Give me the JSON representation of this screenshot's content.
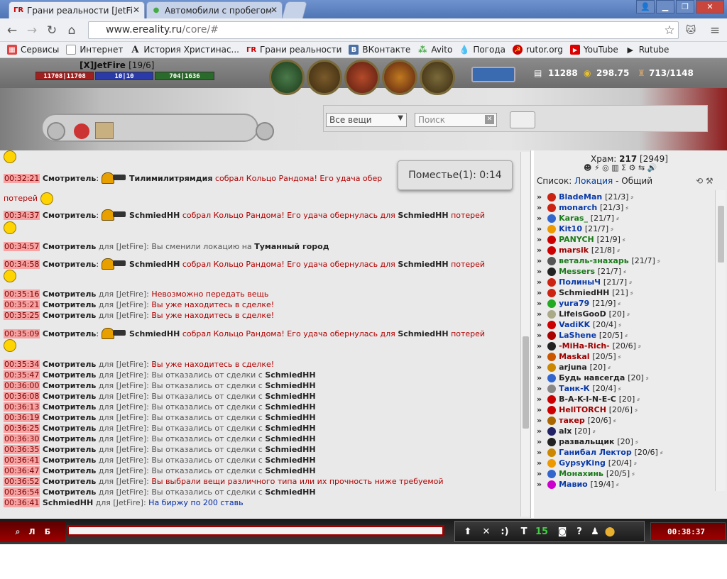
{
  "tabs": [
    {
      "label": "Грани реальности [JetFire"
    },
    {
      "label": "Автомобили с пробегом"
    }
  ],
  "url": {
    "host": "www.ereality.ru",
    "path": "/core/#"
  },
  "bookmarks": [
    "Сервисы",
    "Интернет",
    "История Христинас...",
    "Грани реальности",
    "ВКонтакте",
    "Avito",
    "Погода",
    "rutor.org",
    "YouTube",
    "Rutube"
  ],
  "player": {
    "name": "[X]JetFire",
    "level": "[19/6]",
    "hp": "11708|11708",
    "mana": "10|10",
    "exp": "704|1636"
  },
  "resources": {
    "silver": "11288",
    "gold": "298.75",
    "weight": "713/1148"
  },
  "filter": {
    "category": "Все вещи",
    "search_placeholder": "Поиск"
  },
  "popup": "Поместье(1): 0:14",
  "chat": [
    {
      "t": "00:32:21",
      "who": "Смотритель",
      "to": "",
      "nick": "Тилимилитрямдия",
      "msg": "собрал Кольцо Рандома! Его удача обер",
      "kind": "ring"
    },
    {
      "t": "",
      "who": "",
      "to": "",
      "nick": "",
      "msg": "потерей",
      "kind": "cont"
    },
    {
      "t": "00:34:37",
      "who": "Смотритель",
      "to": "",
      "nick": "SchmiedHH",
      "msg": "собрал Кольцо Рандома! Его удача обернулась для",
      "nick2": "SchmiedHH",
      "msg2": "потерей",
      "kind": "ring"
    },
    {
      "t": "00:34:57",
      "who": "Смотритель",
      "to": "для [JetFire]:",
      "nick": "",
      "msg": "Вы сменили локацию на",
      "bold": "Туманный город",
      "kind": "sys"
    },
    {
      "t": "00:34:58",
      "who": "Смотритель",
      "to": "",
      "nick": "SchmiedHH",
      "msg": "собрал Кольцо Рандома! Его удача обернулась для",
      "nick2": "SchmiedHH",
      "msg2": "потерей",
      "kind": "ring"
    },
    {
      "t": "00:35:16",
      "who": "Смотритель",
      "to": "для [JetFire]:",
      "msg": "Невозможно передать вещь",
      "kind": "red"
    },
    {
      "t": "00:35:21",
      "who": "Смотритель",
      "to": "для [JetFire]:",
      "msg": "Вы уже находитесь в сделке!",
      "kind": "red"
    },
    {
      "t": "00:35:25",
      "who": "Смотритель",
      "to": "для [JetFire]:",
      "msg": "Вы уже находитесь в сделке!",
      "kind": "red"
    },
    {
      "t": "00:35:09",
      "who": "Смотритель",
      "to": "",
      "nick": "SchmiedHH",
      "msg": "собрал Кольцо Рандома! Его удача обернулась для",
      "nick2": "SchmiedHH",
      "msg2": "потерей",
      "kind": "ring"
    },
    {
      "t": "00:35:34",
      "who": "Смотритель",
      "to": "для [JetFire]:",
      "msg": "Вы уже находитесь в сделке!",
      "kind": "red"
    },
    {
      "t": "00:35:47",
      "who": "Смотритель",
      "to": "для [JetFire]:",
      "msg": "Вы отказались от сделки с",
      "bold": "SchmiedHH",
      "kind": "sys"
    },
    {
      "t": "00:36:00",
      "who": "Смотритель",
      "to": "для [JetFire]:",
      "msg": "Вы отказались от сделки с",
      "bold": "SchmiedHH",
      "kind": "sys"
    },
    {
      "t": "00:36:08",
      "who": "Смотритель",
      "to": "для [JetFire]:",
      "msg": "Вы отказались от сделки с",
      "bold": "SchmiedHH",
      "kind": "sys"
    },
    {
      "t": "00:36:13",
      "who": "Смотритель",
      "to": "для [JetFire]:",
      "msg": "Вы отказались от сделки с",
      "bold": "SchmiedHH",
      "kind": "sys"
    },
    {
      "t": "00:36:19",
      "who": "Смотритель",
      "to": "для [JetFire]:",
      "msg": "Вы отказались от сделки с",
      "bold": "SchmiedHH",
      "kind": "sys"
    },
    {
      "t": "00:36:25",
      "who": "Смотритель",
      "to": "для [JetFire]:",
      "msg": "Вы отказались от сделки с",
      "bold": "SchmiedHH",
      "kind": "sys"
    },
    {
      "t": "00:36:30",
      "who": "Смотритель",
      "to": "для [JetFire]:",
      "msg": "Вы отказались от сделки с",
      "bold": "SchmiedHH",
      "kind": "sys"
    },
    {
      "t": "00:36:35",
      "who": "Смотритель",
      "to": "для [JetFire]:",
      "msg": "Вы отказались от сделки с",
      "bold": "SchmiedHH",
      "kind": "sys"
    },
    {
      "t": "00:36:41",
      "who": "Смотритель",
      "to": "для [JetFire]:",
      "msg": "Вы отказались от сделки с",
      "bold": "SchmiedHH",
      "kind": "sys"
    },
    {
      "t": "00:36:47",
      "who": "Смотритель",
      "to": "для [JetFire]:",
      "msg": "Вы отказались от сделки с",
      "bold": "SchmiedHH",
      "kind": "sys"
    },
    {
      "t": "00:36:52",
      "who": "Смотритель",
      "to": "для [JetFire]:",
      "msg": "Вы выбрали вещи различного типа или их прочность ниже требуемой",
      "kind": "red"
    },
    {
      "t": "00:36:54",
      "who": "Смотритель",
      "to": "для [JetFire]:",
      "msg": "Вы отказались от сделки с",
      "bold": "SchmiedHH",
      "kind": "sys"
    },
    {
      "t": "00:36:41",
      "who": "SchmiedHH",
      "to": "для [JetFire]:",
      "msg": "На биржу по 200 ставь",
      "kind": "blue"
    }
  ],
  "right": {
    "temple_label": "Храм:",
    "temple_count": "217",
    "temple_total": "[2949]",
    "list_label": "Список:",
    "loc_link": "Локация",
    "sep": "-",
    "group": "Общий"
  },
  "players": [
    {
      "n": "BladeMan",
      "l": "[21/3]",
      "c": "#0a3aa8",
      "i": "#c21"
    },
    {
      "n": "monarch",
      "l": "[21/3]",
      "c": "#0a3aa8",
      "i": "#c21"
    },
    {
      "n": "Karas_",
      "l": "[21/7]",
      "c": "#1a7a1a",
      "i": "#36c"
    },
    {
      "n": "Kit10",
      "l": "[21/7]",
      "c": "#0a3aa8",
      "i": "#e90"
    },
    {
      "n": "PANYCH",
      "l": "[21/9]",
      "c": "#1a7a1a",
      "i": "#c00"
    },
    {
      "n": "marsik",
      "l": "[21/8]",
      "c": "#a00000",
      "i": "#c00"
    },
    {
      "n": "веталь-знахарь",
      "l": "[21/7]",
      "c": "#1a7a1a",
      "i": "#555"
    },
    {
      "n": "Messers",
      "l": "[21/7]",
      "c": "#1a7a1a",
      "i": "#222"
    },
    {
      "n": "ПолиныЧ",
      "l": "[21/7]",
      "c": "#0a3aa8",
      "i": "#c21"
    },
    {
      "n": "SchmiedHH",
      "l": "[21]",
      "c": "#222",
      "i": "#c21"
    },
    {
      "n": "yura79",
      "l": "[21/9]",
      "c": "#0a3aa8",
      "i": "#2a2"
    },
    {
      "n": "LifeisGooD",
      "l": "[20]",
      "c": "#222",
      "i": "#aa8"
    },
    {
      "n": "VadiKK",
      "l": "[20/4]",
      "c": "#0a3aa8",
      "i": "#c00"
    },
    {
      "n": "LaShene",
      "l": "[20/5]",
      "c": "#0a3aa8",
      "i": "#a00"
    },
    {
      "n": "-MiHa-Rich-",
      "l": "[20/6]",
      "c": "#a00000",
      "i": "#222"
    },
    {
      "n": "Maskal",
      "l": "[20/5]",
      "c": "#a00000",
      "i": "#c50"
    },
    {
      "n": "arjuna",
      "l": "[20]",
      "c": "#222",
      "i": "#c80"
    },
    {
      "n": "Будь навсегда",
      "l": "[20]",
      "c": "#222",
      "i": "#36c"
    },
    {
      "n": "Танк-К",
      "l": "[20/4]",
      "c": "#0a3aa8",
      "i": "#888"
    },
    {
      "n": "B-A-K-I-N-E-C",
      "l": "[20]",
      "c": "#222",
      "i": "#c00"
    },
    {
      "n": "HellTORCH",
      "l": "[20/6]",
      "c": "#a00000",
      "i": "#c00"
    },
    {
      "n": "такер",
      "l": "[20/6]",
      "c": "#a00000",
      "i": "#a60"
    },
    {
      "n": "alx",
      "l": "[20]",
      "c": "#222",
      "i": "#226"
    },
    {
      "n": "развальщик",
      "l": "[20]",
      "c": "#222",
      "i": "#222"
    },
    {
      "n": "Ганибал Лектор",
      "l": "[20/6]",
      "c": "#0a3aa8",
      "i": "#c80"
    },
    {
      "n": "GypsyKing",
      "l": "[20/4]",
      "c": "#0a3aa8",
      "i": "#e90"
    },
    {
      "n": "Монахинь",
      "l": "[20/5]",
      "c": "#1a7a1a",
      "i": "#36c"
    },
    {
      "n": "Мавио",
      "l": "[19/4]",
      "c": "#0a3aa8",
      "i": "#c0c"
    }
  ],
  "bottom": {
    "clock": "00:38:37",
    "btn_l": "Л",
    "btn_b": "Б",
    "t_label": "T",
    "t_num": "15"
  }
}
